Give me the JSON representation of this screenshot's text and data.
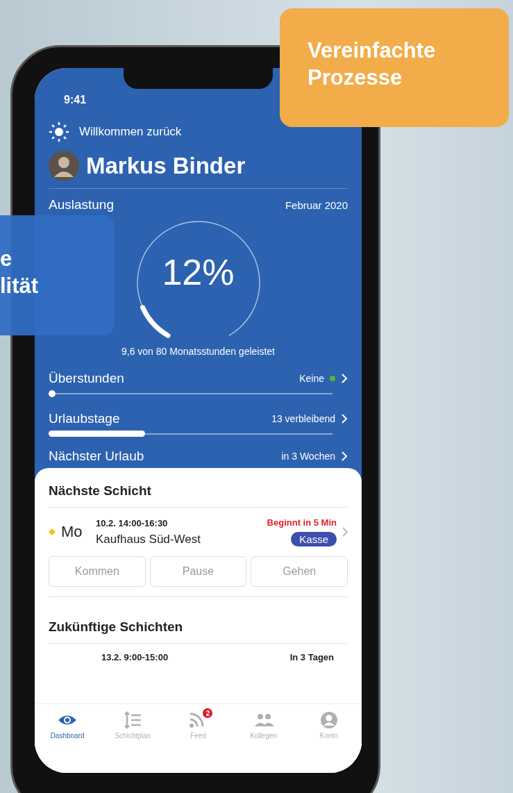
{
  "callouts": [
    {
      "kind": "orange",
      "lines": [
        "Vereinfachte",
        "Prozesse"
      ]
    },
    {
      "kind": "blue",
      "lines": [
        "e",
        "lität"
      ]
    }
  ],
  "status_bar": {
    "time": "9:41"
  },
  "greeting": "Willkommen zurück",
  "user": {
    "name": "Markus Binder"
  },
  "utilization": {
    "label": "Auslastung",
    "period": "Februar 2020",
    "percent": "12%",
    "level": 0.12,
    "caption": "9,6 von 80 Monatsstunden geleistet"
  },
  "stats": [
    {
      "kind": "slider",
      "label": "Überstunden",
      "value": "Keine",
      "color": "#5cb531",
      "level": 0
    },
    {
      "kind": "bar",
      "label": "Urlaubstage",
      "value": "13 verbleibend",
      "level": 0.34
    },
    {
      "kind": "plain",
      "label": "Nächster Urlaub",
      "value": "in 3 Wochen"
    }
  ],
  "next_shift": {
    "title": "Nächste Schicht",
    "day": "Mo",
    "time": "10.2. 14:00-16:30",
    "notice": "Beginnt in 5 Min",
    "place": "Kaufhaus Süd-West",
    "tag": "Kasse",
    "actions": [
      {
        "label": "Kommen",
        "disabled": true
      },
      {
        "label": "Pause",
        "disabled": true
      },
      {
        "label": "Gehen",
        "disabled": true
      }
    ]
  },
  "future_shifts": {
    "title": "Zukünftige Schichten",
    "shifts": [
      {
        "time": "13.2. 9:00-15:00",
        "when": "In 3 Tagen"
      }
    ]
  },
  "tabs": [
    {
      "kind": "eye",
      "label": "Dashboard",
      "selected": true
    },
    {
      "kind": "list",
      "label": "Schichtplan",
      "selected": false
    },
    {
      "kind": "feed",
      "label": "Feed",
      "selected": false,
      "badge": "2"
    },
    {
      "kind": "people",
      "label": "Kollegen",
      "selected": false
    },
    {
      "kind": "person",
      "label": "Konto",
      "selected": false
    }
  ]
}
